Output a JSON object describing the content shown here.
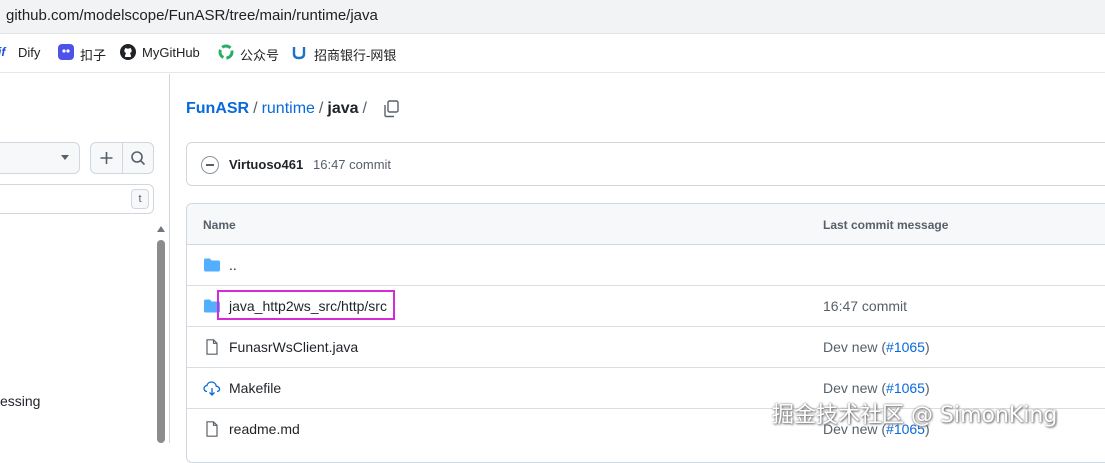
{
  "browser": {
    "address": "github.com/modelscope/FunASR/tree/main/runtime/java"
  },
  "bookmarks": [
    {
      "label": "Dify",
      "icon": "dify-icon"
    },
    {
      "label": "扣子",
      "icon": "coze-icon"
    },
    {
      "label": "MyGitHub",
      "icon": "github-icon"
    },
    {
      "label": "公众号",
      "icon": "wechat-icon"
    },
    {
      "label": "招商银行-网银",
      "icon": "cmb-bank-icon"
    }
  ],
  "sidebar": {
    "filter_kbd": "t",
    "partial_item": "essing"
  },
  "breadcrumb": {
    "repo": "FunASR",
    "folder": "runtime",
    "current": "java",
    "sep": "/"
  },
  "commit": {
    "author": "Virtuoso461",
    "time": "16:47 commit"
  },
  "table": {
    "headers": {
      "name": "Name",
      "message": "Last commit message"
    },
    "rows": [
      {
        "name": "..",
        "type": "folder",
        "message": "",
        "pr": ""
      },
      {
        "name": "java_http2ws_src/http/src",
        "type": "folder",
        "message": "16:47 commit",
        "pr": "",
        "highlighted": true
      },
      {
        "name": "FunasrWsClient.java",
        "type": "file",
        "message": "Dev new (",
        "pr": "#1065",
        "suffix": ")"
      },
      {
        "name": "Makefile",
        "type": "file-sync",
        "message": "Dev new (",
        "pr": "#1065",
        "suffix": ")"
      },
      {
        "name": "readme.md",
        "type": "file",
        "message": "Dev new (",
        "pr": "#1065",
        "suffix": ")"
      }
    ]
  },
  "colors": {
    "link": "#0969da",
    "highlight": "#d62ad6",
    "folder": "#54aeff"
  },
  "watermark": "掘金技术社区 @ SimonKing"
}
